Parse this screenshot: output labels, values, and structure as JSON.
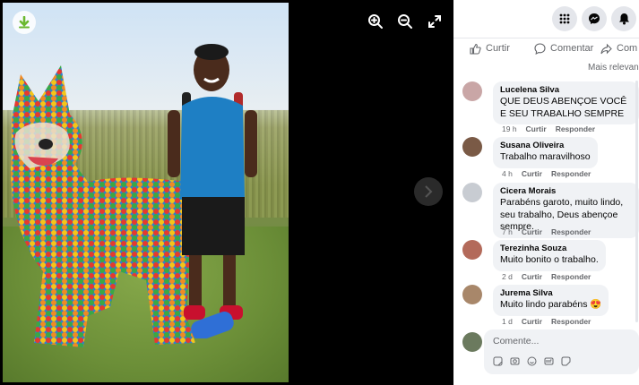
{
  "viewer": {
    "photo_alt": "",
    "tools": [
      {
        "name": "zoom-in",
        "icon": "zoom-in-icon"
      },
      {
        "name": "zoom-out",
        "icon": "zoom-out-icon"
      },
      {
        "name": "fullscreen",
        "icon": "expand-icon"
      }
    ],
    "colors": {
      "background": "#000000",
      "download_arrow": "#6ab82f"
    }
  },
  "topbar": {
    "icons": [
      "grid-menu-icon",
      "messenger-icon",
      "bell-icon"
    ]
  },
  "actions": {
    "like_label": "Curtir",
    "comment_label": "Comentar",
    "share_label": "Com"
  },
  "sort": {
    "label": "Mais relevan"
  },
  "comments": [
    {
      "name": "Lucelena Silva",
      "text": "QUE DEUS ABENÇOE VOCÊ E SEU TRABALHO SEMPRE",
      "time": "19 h",
      "like": "Curtir",
      "reply": "Responder",
      "avatar_color": "#c9a6a6"
    },
    {
      "name": "Susana Oliveira",
      "text": "Trabalho maravilhoso",
      "time": "4 h",
      "like": "Curtir",
      "reply": "Responder",
      "avatar_color": "#7a5a46"
    },
    {
      "name": "Cicera Morais",
      "text": "Parabéns garoto, muito lindo, seu trabalho, Deus abençoe sempre.",
      "time": "7 h",
      "like": "Curtir",
      "reply": "Responder",
      "avatar_color": "#c8ccd2"
    },
    {
      "name": "Terezinha Souza",
      "text": "Muito bonito o trabalho.",
      "time": "2 d",
      "like": "Curtir",
      "reply": "Responder",
      "avatar_color": "#b36a5a"
    },
    {
      "name": "Jurema Silva",
      "text": "Muito lindo parabéns 😍",
      "time": "1 d",
      "like": "Curtir",
      "reply": "Responder",
      "avatar_color": "#a8876a"
    }
  ],
  "composer": {
    "placeholder": "Comente...",
    "tools": [
      "sticker-icon",
      "gif-camera-icon",
      "emoji-icon",
      "gif-icon",
      "sticker-smile-icon"
    ]
  },
  "colors": {
    "brand": "#1877f2",
    "bubble": "#f0f2f5",
    "muted": "#65676b"
  }
}
